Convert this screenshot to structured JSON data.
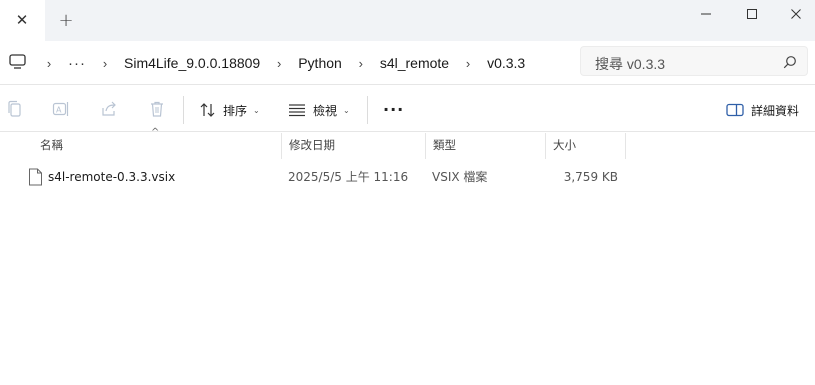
{
  "tabs": {
    "new_tab": "+",
    "close": "✕"
  },
  "address": {
    "ellipsis": "···",
    "breadcrumbs": [
      "Sim4Life_9.0.0.18809",
      "Python",
      "s4l_remote",
      "v0.3.3"
    ]
  },
  "search": {
    "placeholder": "搜尋 v0.3.3"
  },
  "toolbar": {
    "sort_label": "排序",
    "view_label": "檢視",
    "more_label": "···",
    "details_label": "詳細資料"
  },
  "columns": {
    "name": "名稱",
    "modified": "修改日期",
    "type": "類型",
    "size": "大小"
  },
  "files": [
    {
      "name": "s4l-remote-0.3.3.vsix",
      "modified": "2025/5/5 上午 11:16",
      "type": "VSIX 檔案",
      "size": "3,759 KB"
    }
  ]
}
